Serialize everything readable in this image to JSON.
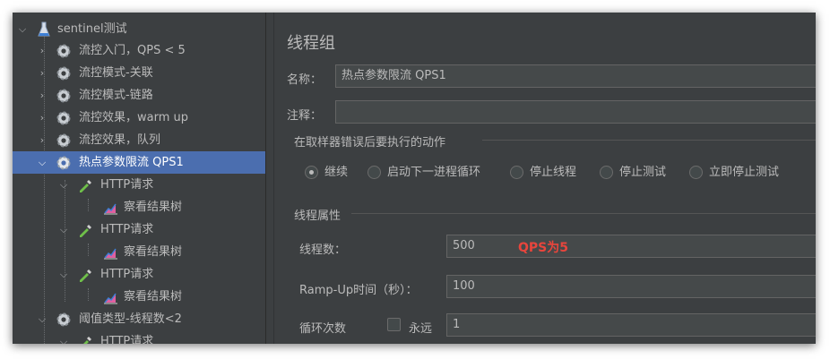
{
  "tree": {
    "rows": [
      {
        "label": "sentinel测试",
        "icon": "flask-icon"
      },
      {
        "label": "流控入门，QPS < 5",
        "icon": "gear-icon"
      },
      {
        "label": "流控模式-关联",
        "icon": "gear-icon"
      },
      {
        "label": "流控模式-链路",
        "icon": "gear-icon"
      },
      {
        "label": "流控效果，warm up",
        "icon": "gear-icon"
      },
      {
        "label": "流控效果，队列",
        "icon": "gear-icon"
      },
      {
        "label": "热点参数限流 QPS1",
        "icon": "gear-icon"
      },
      {
        "label": "HTTP请求",
        "icon": "pipette-icon"
      },
      {
        "label": "察看结果树",
        "icon": "chart-icon"
      },
      {
        "label": "HTTP请求",
        "icon": "pipette-icon"
      },
      {
        "label": "察看结果树",
        "icon": "chart-icon"
      },
      {
        "label": "HTTP请求",
        "icon": "pipette-icon"
      },
      {
        "label": "察看结果树",
        "icon": "chart-icon"
      },
      {
        "label": "阈值类型-线程数<2",
        "icon": "gear-icon"
      },
      {
        "label": "HTTP请求",
        "icon": "pipette-icon"
      }
    ]
  },
  "panel": {
    "title": "线程组",
    "name_label": "名称：",
    "name_value": "热点参数限流 QPS1",
    "comment_label": "注释：",
    "comment_value": "",
    "error_action_heading": "在取样器错误后要执行的动作",
    "error_actions": [
      "继续",
      "启动下一进程循环",
      "停止线程",
      "停止测试",
      "立即停止测试"
    ],
    "selected_action": "继续",
    "thread_props_heading": "线程属性",
    "threads_label": "线程数：",
    "threads_value": "500",
    "annotation": "QPS为5",
    "rampup_label": "Ramp-Up时间（秒）：",
    "rampup_value": "100",
    "loop_label": "循环次数",
    "forever_label": "永远",
    "forever_checked": false,
    "loop_value": "1"
  },
  "colors": {
    "background": "#3c3f41",
    "selection": "#4b6eaf",
    "text": "#bbbbbb",
    "field_bg": "#45494a",
    "annotation": "#e8453c"
  }
}
